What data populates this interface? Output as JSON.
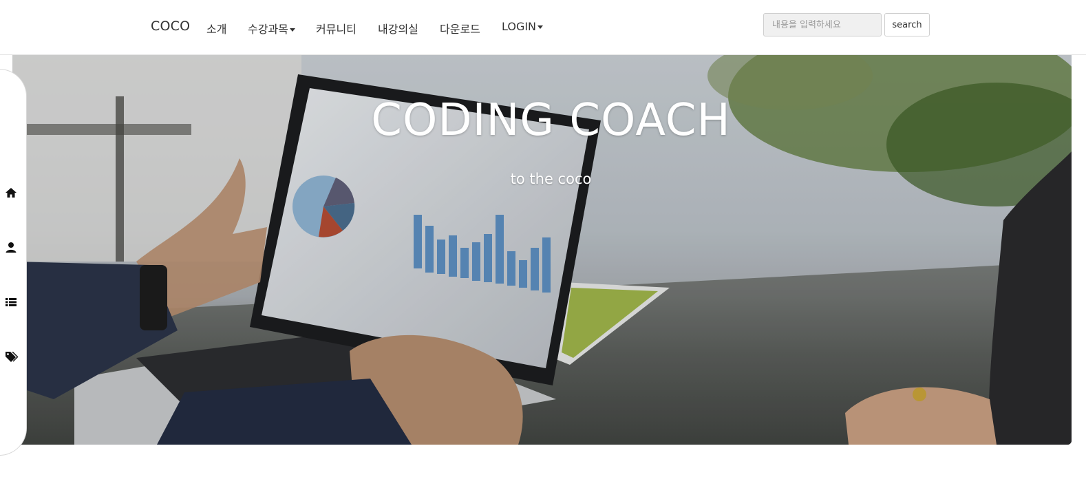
{
  "navbar": {
    "brand": "COCO",
    "items": [
      {
        "label": "소개",
        "dropdown": false
      },
      {
        "label": "수강과목",
        "dropdown": true
      },
      {
        "label": "커뮤니티",
        "dropdown": false
      },
      {
        "label": "내강의실",
        "dropdown": false
      },
      {
        "label": "다운로드",
        "dropdown": false
      },
      {
        "label": "LOGIN",
        "dropdown": true
      }
    ],
    "search": {
      "placeholder": "내용을 입력하세요",
      "value": "",
      "button_label": "search"
    }
  },
  "hero": {
    "title": "CODING COACH",
    "subtitle": "to the coco"
  },
  "side_panel": {
    "icons": [
      "home-icon",
      "user-icon",
      "list-icon",
      "tags-icon"
    ]
  },
  "colors": {
    "text": "#333333",
    "hero_text": "#ffffff",
    "navbar_bg": "#ffffff",
    "input_bg": "#f0f0f0",
    "border": "#cfcfcf"
  }
}
